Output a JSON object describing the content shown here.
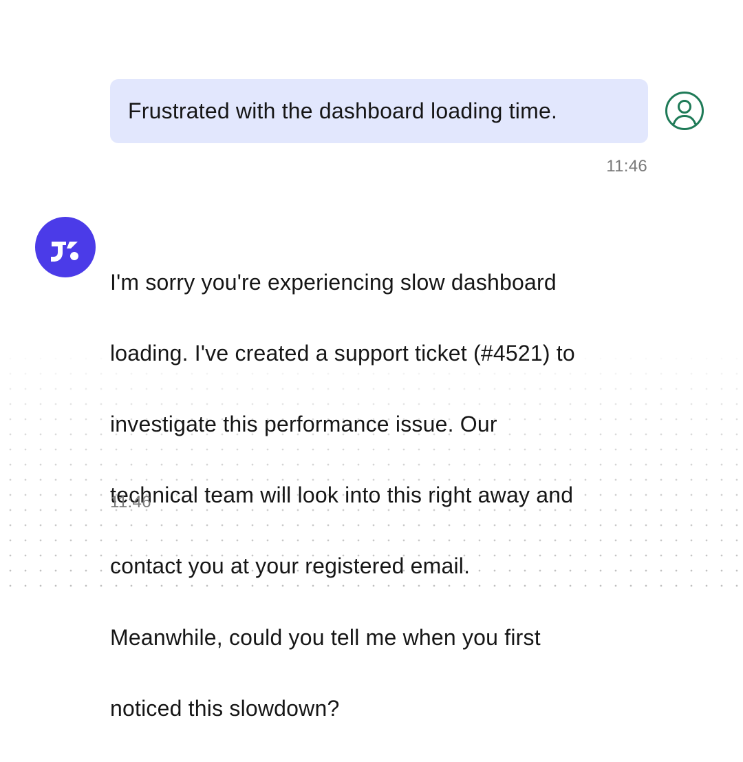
{
  "conversation": {
    "user_message": {
      "text": "Frustrated with the dashboard loading time.",
      "time": "11:46",
      "avatar_icon": "user-circle-icon",
      "avatar_color": "#1e7a57"
    },
    "bot_message": {
      "lines": [
        "I'm sorry you're experiencing slow dashboard",
        "loading. I've created a support ticket (#4521) to",
        "investigate this performance issue. Our",
        "technical team will look into this right away and",
        "contact you at your registered email.",
        "Meanwhile, could you tell me when you first",
        "noticed this slowdown?"
      ],
      "time": "11:46",
      "avatar_icon": "bot-logo-icon",
      "avatar_color": "#4b3be8"
    },
    "colors": {
      "user_bubble": "#e2e7fd",
      "timestamp": "#7a7a7a",
      "background_dots": "#bdbdbd"
    }
  }
}
